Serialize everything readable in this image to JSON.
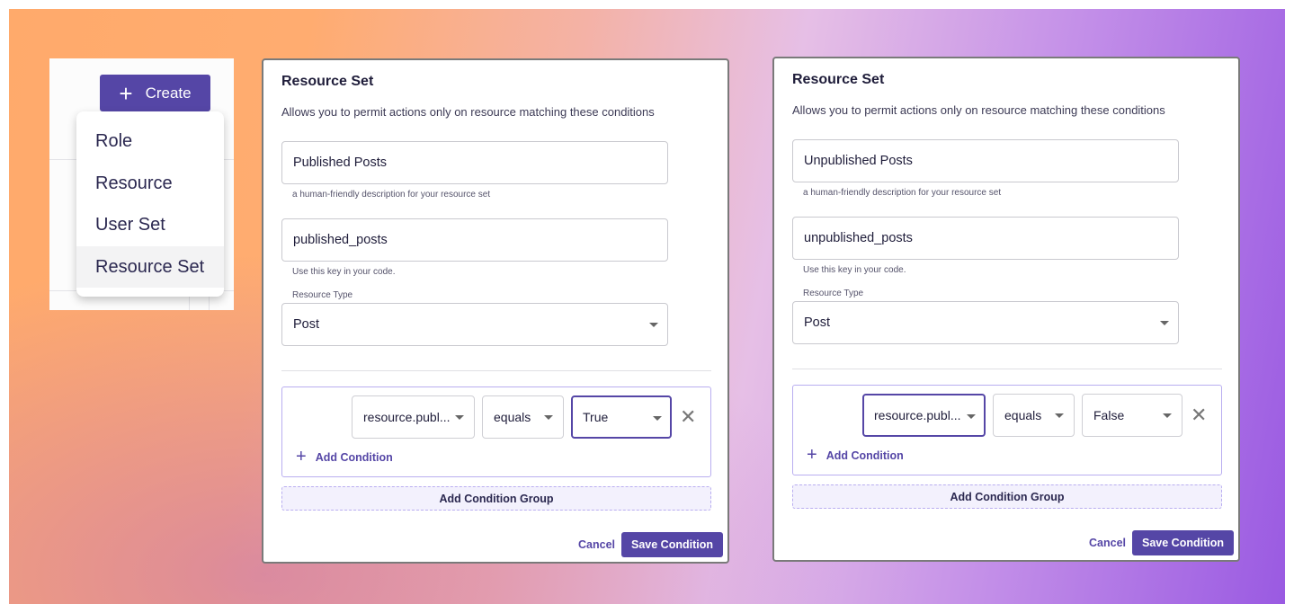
{
  "create_menu": {
    "button_label": "Create",
    "items": [
      {
        "label": "Role"
      },
      {
        "label": "Resource"
      },
      {
        "label": "User Set"
      },
      {
        "label": "Resource Set",
        "hovered": true
      }
    ]
  },
  "modals": [
    {
      "title": "Resource Set",
      "subtitle": "Allows you to permit actions only on resource matching these conditions",
      "name_value": "Published Posts",
      "name_help": "a human-friendly description for your resource set",
      "key_value": "published_posts",
      "key_help": "Use this key in your code.",
      "resource_type_label": "Resource Type",
      "resource_type_value": "Post",
      "condition": {
        "attribute": "resource.publ...",
        "operator": "equals",
        "value": "True",
        "focused": "value"
      },
      "add_condition": "Add Condition",
      "add_condition_group": "Add Condition Group",
      "cancel": "Cancel",
      "save": "Save Condition"
    },
    {
      "title": "Resource Set",
      "subtitle": "Allows you to permit actions only on resource matching these conditions",
      "name_value": "Unpublished Posts",
      "name_help": "a human-friendly description for your resource set",
      "key_value": "unpublished_posts",
      "key_help": "Use this key in your code.",
      "resource_type_label": "Resource Type",
      "resource_type_value": "Post",
      "condition": {
        "attribute": "resource.publ...",
        "operator": "equals",
        "value": "False",
        "focused": "attribute"
      },
      "add_condition": "Add Condition",
      "add_condition_group": "Add Condition Group",
      "cancel": "Cancel",
      "save": "Save Condition"
    }
  ],
  "colors": {
    "accent": "#5546a6",
    "group_border": "#b9aef0",
    "group_bg": "#f3f1fd"
  }
}
